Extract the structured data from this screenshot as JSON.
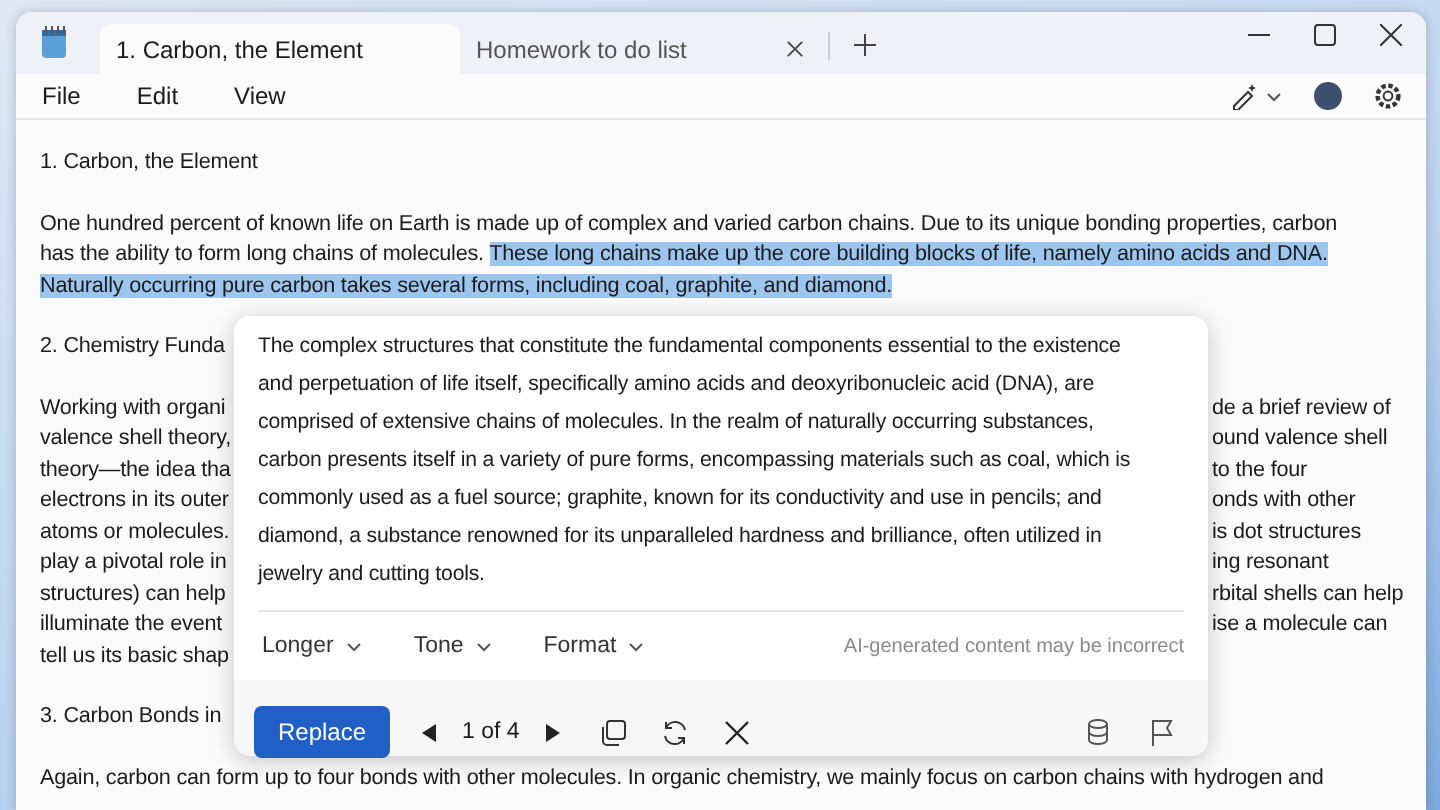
{
  "tabs": [
    {
      "title": "1. Carbon, the Element",
      "selected": true
    },
    {
      "title": "Homework to do list",
      "selected": false
    }
  ],
  "menu": [
    "File",
    "Edit",
    "View"
  ],
  "document": [
    {
      "kind": "line",
      "text": "1. Carbon, the Element"
    },
    {
      "kind": "blank"
    },
    {
      "kind": "paragraph",
      "segments": [
        {
          "text": "One hundred percent of known life on Earth is made up of complex and varied carbon chains. Due to its unique bonding properties, carbon has the ability to form long chains of molecules. ",
          "selected": false
        },
        {
          "text": "These long chains make up the core building blocks of life, namely amino acids and DNA. Naturally occurring pure carbon takes several forms, including coal, graphite, and diamond.",
          "selected": true
        }
      ]
    },
    {
      "kind": "blank"
    },
    {
      "kind": "split",
      "left": "2. Chemistry Funda"
    },
    {
      "kind": "blank"
    },
    {
      "kind": "split",
      "left": "Working with organi",
      "right": "de a brief review of"
    },
    {
      "kind": "split",
      "left": "valence shell theory,",
      "right": "ound valence shell"
    },
    {
      "kind": "split",
      "left": "theory—the idea tha",
      "right": "to the four"
    },
    {
      "kind": "split",
      "left": "electrons in its outer",
      "right": "onds with other"
    },
    {
      "kind": "split",
      "left": "atoms or molecules.",
      "right": "is dot structures"
    },
    {
      "kind": "split",
      "left": "play a pivotal role in",
      "right": "ing resonant"
    },
    {
      "kind": "split",
      "left": "structures) can help",
      "right": "rbital shells can help"
    },
    {
      "kind": "split",
      "left": "illuminate the event",
      "right": "ise a molecule can"
    },
    {
      "kind": "split",
      "left": "tell us its basic shap"
    },
    {
      "kind": "blank"
    },
    {
      "kind": "split",
      "left": "3. Carbon Bonds in"
    },
    {
      "kind": "blank"
    },
    {
      "kind": "line",
      "text": "Again, carbon can form up to four bonds with other molecules. In organic chemistry, we mainly focus on carbon chains with hydrogen and"
    }
  ],
  "rewrite_popup": {
    "text": "The complex structures that constitute the fundamental components essential to the existence and perpetuation of life itself, specifically amino acids and deoxyribonucleic acid (DNA), are comprised of extensive chains of molecules. In the realm of naturally occurring substances, carbon presents itself in a variety of pure forms, encompassing materials such as coal, which is commonly used as a fuel source; graphite, known for its conductivity and use in pencils; and diamond, a substance renowned for its unparalleled hardness and brilliance, often utilized in jewelry and cutting tools.",
    "options": [
      "Longer",
      "Tone",
      "Format"
    ],
    "disclaimer": "AI-generated content may be incorrect",
    "replace_button": "Replace",
    "counter": "1 of 4"
  }
}
